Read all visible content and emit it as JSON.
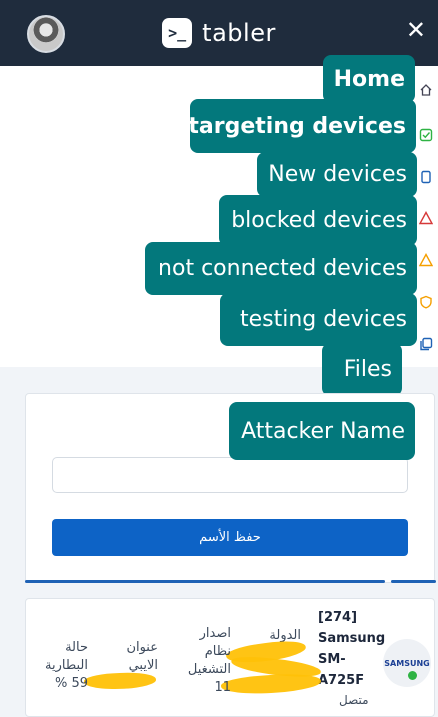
{
  "header": {
    "brand_mark": ">_",
    "brand_name": "tabler",
    "close": "✕"
  },
  "menu_tooltips": [
    {
      "label": "Home",
      "bold": true
    },
    {
      "label": "targeting devices",
      "bold": true
    },
    {
      "label": "New devices",
      "bold": false
    },
    {
      "label": "blocked devices",
      "bold": false
    },
    {
      "label": "not connected devices",
      "bold": false
    },
    {
      "label": "testing devices",
      "bold": false
    },
    {
      "label": "Files",
      "bold": false
    }
  ],
  "attacker_tooltip": "Attacker Name",
  "form": {
    "name_value": "",
    "save_label": "حفظ الأسم"
  },
  "device": {
    "id": "[274]",
    "model": "Samsung SM-A725F",
    "status": "متصل",
    "logo_text": "SAMSUNG",
    "country_label": "الدولة",
    "os_label": "اصدار نظام التشغيل",
    "os_value": "11",
    "ip_label": "عنوان الايبي",
    "battery_label": "حالة البطارية",
    "battery_value": "59 %"
  },
  "colors": {
    "topbar": "#1f2c3d",
    "tooltip": "#03787c",
    "primary": "#0d63c6",
    "online": "#2fb344"
  }
}
